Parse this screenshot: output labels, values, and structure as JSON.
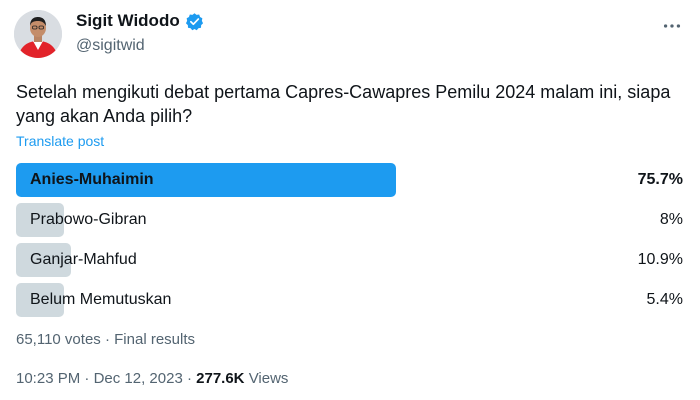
{
  "author": {
    "display_name": "Sigit Widodo",
    "handle": "@sigitwid",
    "verified": true
  },
  "tweet": {
    "text": "Setelah mengikuti debat pertama Capres-Cawapres Pemilu 2024 malam ini, siapa yang akan Anda pilih?",
    "translate_label": "Translate post"
  },
  "poll": {
    "options": [
      {
        "label": "Anies-Muhaimin",
        "percent_text": "75.7%",
        "percent": 75.7,
        "winner": true
      },
      {
        "label": "Prabowo-Gibran",
        "percent_text": "8%",
        "percent": 8,
        "winner": false
      },
      {
        "label": "Ganjar-Mahfud",
        "percent_text": "10.9%",
        "percent": 10.9,
        "winner": false
      },
      {
        "label": "Belum Memutuskan",
        "percent_text": "5.4%",
        "percent": 5.4,
        "winner": false
      }
    ],
    "votes_text": "65,110 votes",
    "separator": "·",
    "status_text": "Final results"
  },
  "meta": {
    "time": "10:23 PM",
    "separator": "·",
    "date": "Dec 12, 2023",
    "views_count": "277.6K",
    "views_label": "Views"
  },
  "colors": {
    "accent": "#1d9bf0",
    "bar_gray": "#cfd9de",
    "text_primary": "#0f1419",
    "text_secondary": "#536471"
  },
  "icons": {
    "verified": "verified-badge-icon",
    "more": "more-horizontal-icon"
  }
}
